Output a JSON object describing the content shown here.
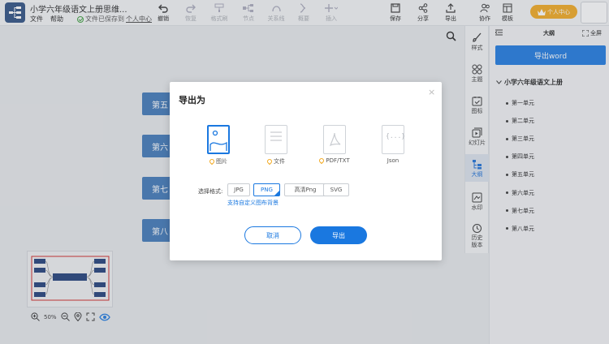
{
  "app": {
    "title": "小学六年级语文上册思维...",
    "menu": [
      "文件",
      "帮助"
    ],
    "save_status": {
      "prefix": "文件已保存到",
      "link": "个人中心"
    }
  },
  "toolbar": {
    "undo": "撤销",
    "redo": "恢复",
    "format_painter": "格式刷",
    "node": "节点",
    "relation": "关系线",
    "summary": "概要",
    "insert": "插入",
    "save": "保存",
    "share": "分享",
    "export": "导出",
    "collab": "协作",
    "template": "模板"
  },
  "user": {
    "vip_label": "个人中心"
  },
  "canvas": {
    "nodes": [
      "第五",
      "第六",
      "第七",
      "第八"
    ],
    "zoom_level": "50%"
  },
  "side_tools": [
    "样式",
    "主题",
    "图标",
    "幻灯片",
    "大纲",
    "水印",
    "历史版本"
  ],
  "outline": {
    "title": "大纲",
    "fullscreen": "全屏",
    "export_word": "导出word",
    "root": "小学六年级语文上册",
    "items": [
      "第一单元",
      "第二单元",
      "第三单元",
      "第四单元",
      "第五单元",
      "第六单元",
      "第七单元",
      "第八单元"
    ]
  },
  "dialog": {
    "title": "导出为",
    "formats": [
      "图片",
      "文件",
      "PDF/TXT",
      "Json"
    ],
    "format_select_label": "选择格式:",
    "options": [
      "JPG",
      "PNG",
      "高清Png",
      "SVG"
    ],
    "selected_option": "PNG",
    "custom_link": "支持自定义图布背景",
    "cancel": "取消",
    "confirm": "导出",
    "close": "×"
  },
  "colors": {
    "accent": "#1a78e0",
    "node_blue": "#3d76b8",
    "brand_dark": "#2b4d80",
    "vip_orange": "#f2a81d"
  }
}
